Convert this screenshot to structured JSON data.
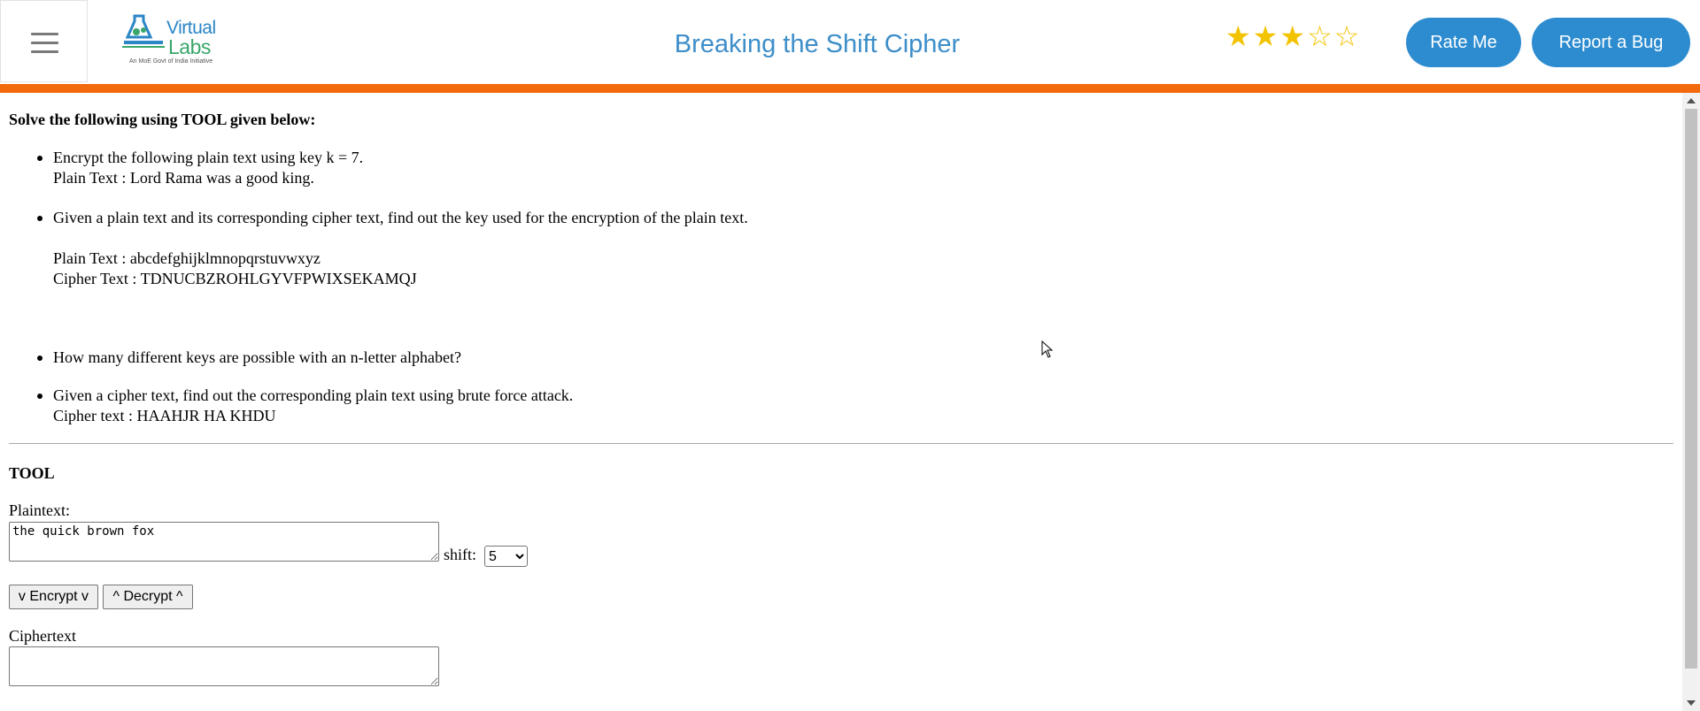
{
  "header": {
    "logo": {
      "line1": "Virtual",
      "line2": "Labs",
      "tagline": "An MoE Govt of India Initiative"
    },
    "title": "Breaking the Shift Cipher",
    "rating": {
      "filled": 3,
      "total": 5
    },
    "rate_label": "Rate Me",
    "bug_label": "Report a Bug"
  },
  "content": {
    "intro": "Solve the following using TOOL given below:",
    "tasks": [
      {
        "line1": "Encrypt the following plain text using key k = 7.",
        "line2": "Plain Text : Lord Rama was a good king."
      },
      {
        "line1": "Given a plain text and its corresponding cipher text, find out the key used for the encryption of the plain text.",
        "line2": "Plain Text : abcdefghijklmnopqrstuvwxyz",
        "line3": "Cipher Text : TDNUCBZROHLGYVFPWIXSEKAMQJ"
      },
      {
        "line1": "How many different keys are possible with an n-letter alphabet?"
      },
      {
        "line1": "Given a cipher text, find out the corresponding plain text using brute force attack.",
        "line2": "Cipher text : HAAHJR HA KHDU"
      }
    ]
  },
  "tool": {
    "title": "TOOL",
    "plaintext_label": "Plaintext:",
    "plaintext_value": "the quick brown fox",
    "shift_label": "shift:",
    "shift_value": "5",
    "encrypt_label": "v Encrypt v",
    "decrypt_label": "^ Decrypt ^",
    "ciphertext_label": "Ciphertext",
    "ciphertext_value": ""
  },
  "colors": {
    "accent_orange": "#f26a0d",
    "button_blue": "#2d8cd0",
    "title_blue": "#3d8ec9",
    "star": "#f2c300"
  }
}
